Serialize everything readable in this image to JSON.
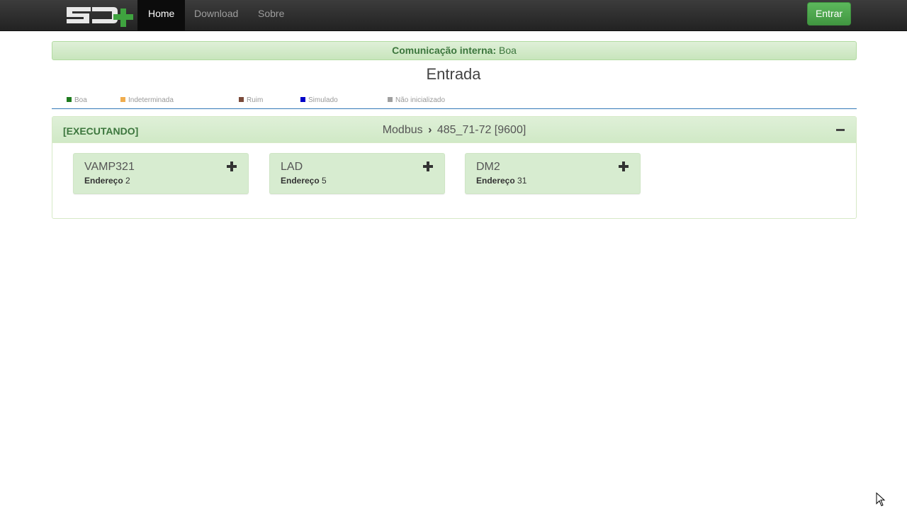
{
  "navbar": {
    "logo_text": "SD+",
    "items": [
      {
        "label": "Home",
        "active": true
      },
      {
        "label": "Download",
        "active": false
      },
      {
        "label": "Sobre",
        "active": false
      }
    ],
    "login_label": "Entrar",
    "login_color": "#5cb85c"
  },
  "comm": {
    "label": "Comunicação interna:",
    "value": "Boa"
  },
  "page_title": "Entrada",
  "legend": [
    {
      "label": "Boa",
      "color": "#1e7b1e"
    },
    {
      "label": "Indeterminada",
      "color": "#f0ad4e"
    },
    {
      "label": "Ruim",
      "color": "#7a4a3a"
    },
    {
      "label": "Simulado",
      "color": "#0000c8"
    },
    {
      "label": "Não inicializado",
      "color": "#a0a0a0"
    }
  ],
  "panel": {
    "status": "[EXECUTANDO]",
    "protocol": "Modbus",
    "port": "485_71-72 [9600]"
  },
  "devices": [
    {
      "name": "VAMP321",
      "address_label": "Endereço",
      "address": "2"
    },
    {
      "name": "LAD",
      "address_label": "Endereço",
      "address": "5"
    },
    {
      "name": "DM2",
      "address_label": "Endereço",
      "address": "31"
    }
  ]
}
